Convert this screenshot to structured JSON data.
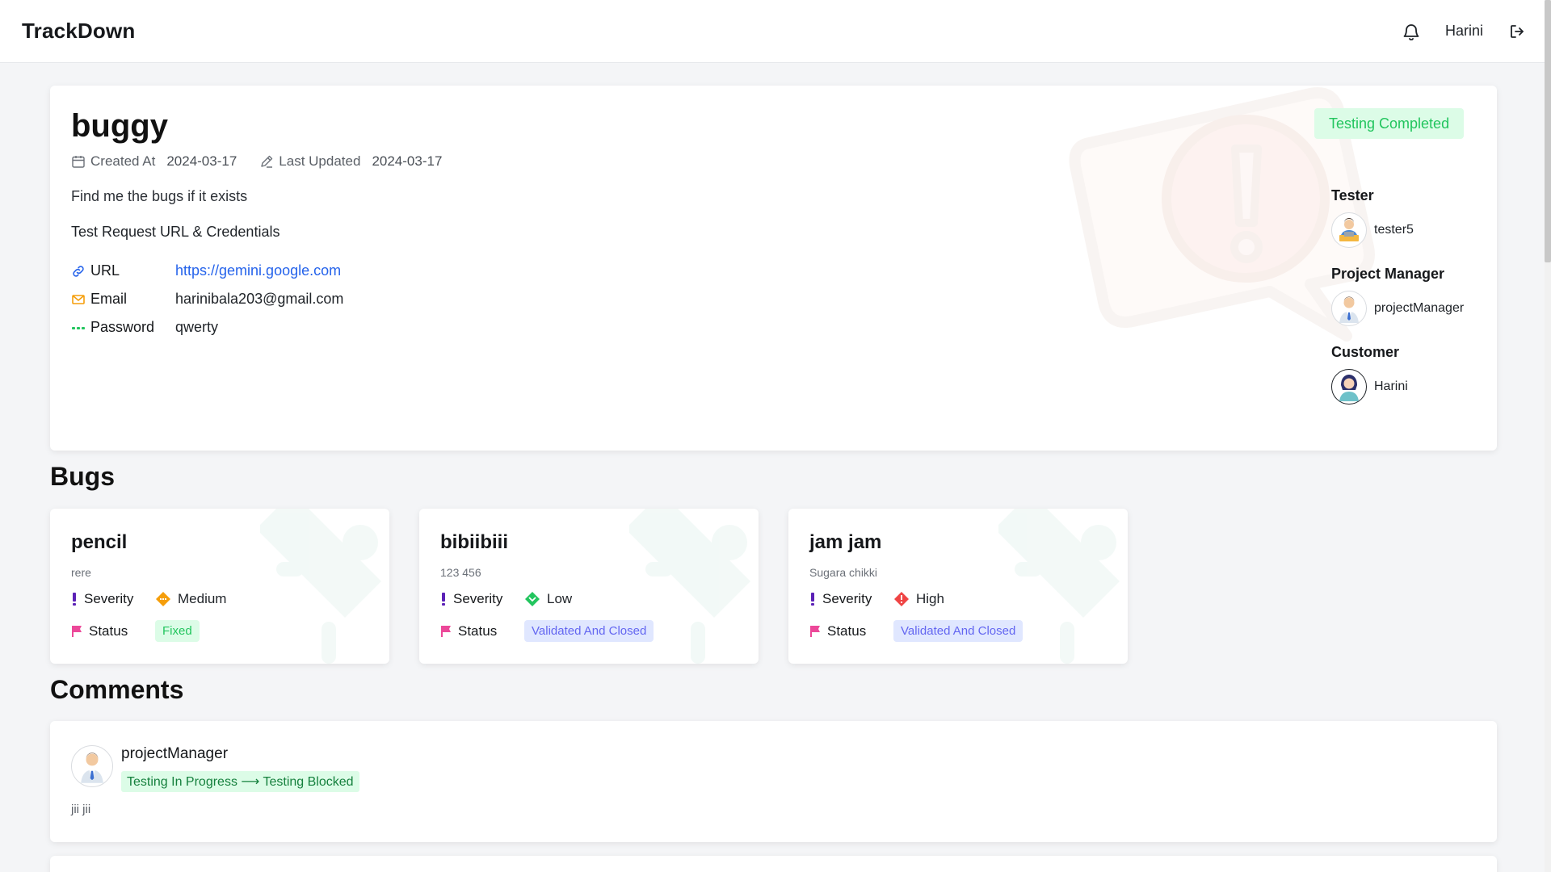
{
  "app": {
    "brand": "TrackDown",
    "user_name": "Harini"
  },
  "project": {
    "title": "buggy",
    "created_label": "Created At",
    "created_value": "2024-03-17",
    "updated_label": "Last Updated",
    "updated_value": "2024-03-17",
    "description": "Find me the bugs if it exists",
    "credentials_title": "Test Request URL & Credentials",
    "credentials": {
      "url_label": "URL",
      "url_value": "https://gemini.google.com",
      "email_label": "Email",
      "email_value": "harinibala203@gmail.com",
      "password_label": "Password",
      "password_value": "qwerty"
    },
    "status": "Testing Completed",
    "people": [
      {
        "role": "Tester",
        "name": "tester5",
        "avatar_icon": "tester-avatar-icon"
      },
      {
        "role": "Project Manager",
        "name": "projectManager",
        "avatar_icon": "manager-avatar-icon"
      },
      {
        "role": "Customer",
        "name": "Harini",
        "avatar_icon": "customer-avatar-icon"
      }
    ]
  },
  "bugs_section": {
    "title": "Bugs",
    "severity_label": "Severity",
    "status_label": "Status",
    "items": [
      {
        "title": "pencil",
        "description": "rere",
        "severity": "Medium",
        "severity_color": "#f59e0b",
        "status": "Fixed"
      },
      {
        "title": "bibiibiii",
        "description": "123 456",
        "severity": "Low",
        "severity_color": "#22c55e",
        "status": "Validated And Closed"
      },
      {
        "title": "jam jam",
        "description": "Sugara chikki",
        "severity": "High",
        "severity_color": "#ef4444",
        "status": "Validated And Closed"
      }
    ]
  },
  "comments_section": {
    "title": "Comments",
    "items": [
      {
        "author": "projectManager",
        "transition": "Testing In Progress ⟶ Testing Blocked",
        "text": "jii jii"
      }
    ]
  },
  "colors": {
    "accent_green": "#22c55e",
    "accent_indigo": "#6366f1",
    "link_blue": "#2563eb"
  }
}
